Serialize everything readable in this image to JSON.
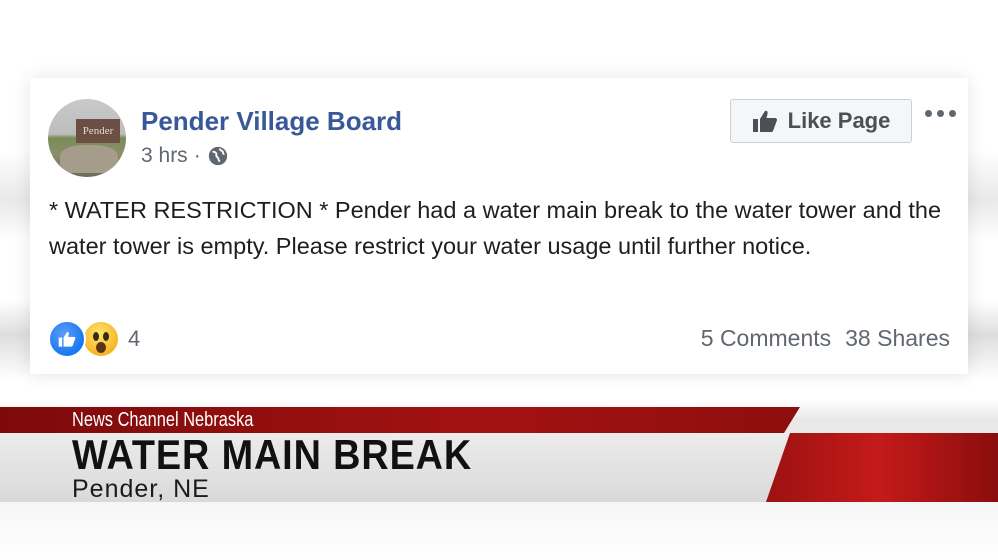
{
  "post": {
    "page_name": "Pender Village Board",
    "avatar_sign_text": "Pender",
    "time": "3 hrs",
    "separator": "·",
    "privacy_icon": "globe-icon",
    "like_page_label": "Like Page",
    "like_page_icon": "thumbs-up-icon",
    "more_icon": "more-dots-icon",
    "text": "* WATER RESTRICTION * Pender had a water main break to the water tower and the water tower is empty. Please restrict your water usage until further notice.",
    "reactions": [
      "like",
      "wow"
    ],
    "reaction_count": "4",
    "comments": "5 Comments",
    "shares": "38 Shares"
  },
  "lower_third": {
    "network": "News Channel Nebraska",
    "headline": "WATER MAIN BREAK",
    "location": "Pender, NE"
  },
  "colors": {
    "page_name": "#385898",
    "secondary_text": "#616770",
    "banner_red": "#a31212",
    "banner_grey": "#e2e2e2",
    "like_blue": "#1877f2",
    "wow_yellow": "#f7b125"
  }
}
